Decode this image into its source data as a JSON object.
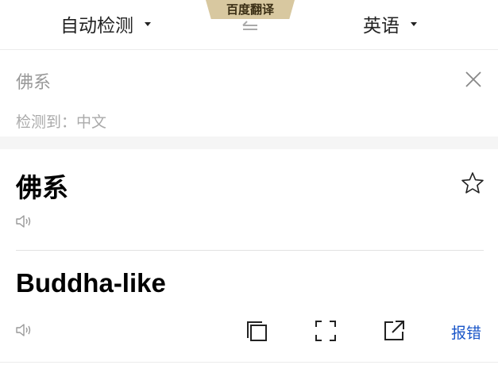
{
  "header": {
    "source_lang": "自动检测",
    "target_lang": "英语",
    "brand": "百度翻译",
    "swap_icon": "swap-arrow-icon"
  },
  "input": {
    "text": "佛系",
    "detected": "检测到：中文",
    "clear_icon": "close-icon"
  },
  "result": {
    "source_word": "佛系",
    "translation": "Buddha-like",
    "favorite_icon": "star-icon",
    "speaker_icon": "speaker-icon",
    "report_label": "报错"
  },
  "toolbar": {
    "icons": [
      "copy-icon",
      "fullscreen-icon",
      "share-icon"
    ]
  },
  "colors": {
    "accent": "#1a56c8",
    "brand_bg": "#d8c8a0",
    "muted_text": "#999999"
  }
}
